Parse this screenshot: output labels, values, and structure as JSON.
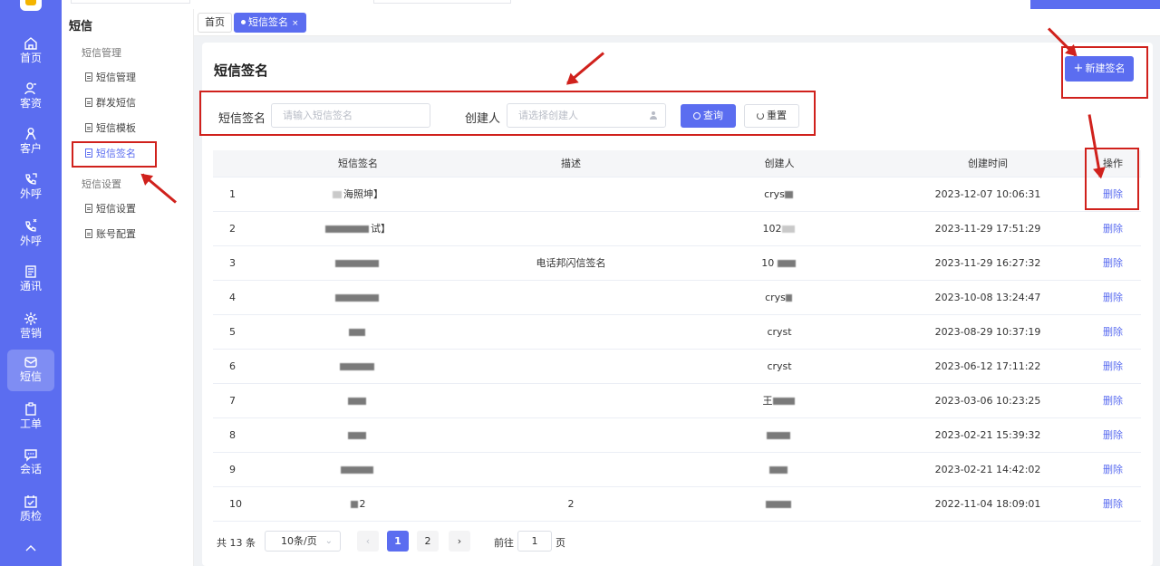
{
  "rail": {
    "items": [
      {
        "label": "首页"
      },
      {
        "label": "客资"
      },
      {
        "label": "客户"
      },
      {
        "label": "外呼"
      },
      {
        "label": "外呼"
      },
      {
        "label": "通讯"
      },
      {
        "label": "营销"
      },
      {
        "label": "短信"
      },
      {
        "label": "工单"
      },
      {
        "label": "会话"
      },
      {
        "label": "质检"
      }
    ]
  },
  "submenu": {
    "title": "短信",
    "group1": "短信管理",
    "items1": [
      "短信管理",
      "群发短信",
      "短信模板",
      "短信签名"
    ],
    "group2": "短信设置",
    "items2": [
      "短信设置",
      "账号配置"
    ]
  },
  "tabs": {
    "home": "首页",
    "current": "短信签名",
    "close": "×"
  },
  "page": {
    "title": "短信签名",
    "new_button": "新建签名"
  },
  "filter": {
    "sign_label": "短信签名",
    "sign_placeholder": "请输入短信签名",
    "creator_label": "创建人",
    "creator_placeholder": "请选择创建人",
    "query_button": "查询",
    "reset_button": "重置"
  },
  "table": {
    "columns": {
      "sign": "短信签名",
      "desc": "描述",
      "creator": "创建人",
      "time": "创建时间",
      "action": "操作"
    },
    "rows": [
      {
        "index": "1",
        "sign": "海照坤】",
        "desc": "",
        "creator": "crys",
        "time": "2023-12-07 10:06:31",
        "action": "删除"
      },
      {
        "index": "2",
        "sign": "试】",
        "desc": "",
        "creator": "102",
        "time": "2023-11-29 17:51:29",
        "action": "删除"
      },
      {
        "index": "3",
        "sign": "",
        "desc": "电话邦闪信签名",
        "creator": "10",
        "time": "2023-11-29 16:27:32",
        "action": "删除"
      },
      {
        "index": "4",
        "sign": "",
        "desc": "",
        "creator": "crys",
        "time": "2023-10-08 13:24:47",
        "action": "删除"
      },
      {
        "index": "5",
        "sign": "",
        "desc": "",
        "creator": "cryst",
        "time": "2023-08-29 10:37:19",
        "action": "删除"
      },
      {
        "index": "6",
        "sign": "",
        "desc": "",
        "creator": "cryst",
        "time": "2023-06-12 17:11:22",
        "action": "删除"
      },
      {
        "index": "7",
        "sign": "",
        "desc": "",
        "creator": "王",
        "time": "2023-03-06 10:23:25",
        "action": "删除"
      },
      {
        "index": "8",
        "sign": "",
        "desc": "",
        "creator": "",
        "time": "2023-02-21 15:39:32",
        "action": "删除"
      },
      {
        "index": "9",
        "sign": "",
        "desc": "",
        "creator": "",
        "time": "2023-02-21 14:42:02",
        "action": "删除"
      },
      {
        "index": "10",
        "sign": "2",
        "desc": "2",
        "creator": "",
        "time": "2022-11-04 18:09:01",
        "action": "删除"
      }
    ]
  },
  "pagination": {
    "total": "共 13 条",
    "page_size": "10条/页",
    "pages": [
      "1",
      "2"
    ],
    "current_page": "1",
    "goto_label": "前往",
    "goto_value": "1",
    "goto_unit": "页",
    "prev_icon": "‹",
    "next_icon": "›"
  },
  "colors": {
    "primary": "#5b6df0",
    "annotation": "#d0211c"
  }
}
